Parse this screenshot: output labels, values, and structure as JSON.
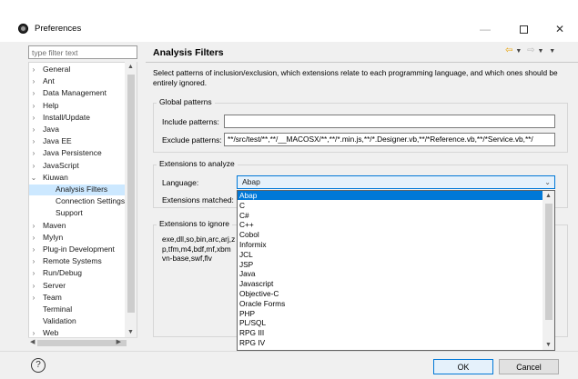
{
  "window": {
    "title": "Preferences",
    "minimize_glyph": "—",
    "close_glyph": "✕"
  },
  "filter": {
    "placeholder": "type filter text"
  },
  "tree": {
    "items": [
      {
        "label": "General",
        "arrow": "›",
        "level": 0
      },
      {
        "label": "Ant",
        "arrow": "›",
        "level": 0
      },
      {
        "label": "Data Management",
        "arrow": "›",
        "level": 0
      },
      {
        "label": "Help",
        "arrow": "›",
        "level": 0
      },
      {
        "label": "Install/Update",
        "arrow": "›",
        "level": 0
      },
      {
        "label": "Java",
        "arrow": "›",
        "level": 0
      },
      {
        "label": "Java EE",
        "arrow": "›",
        "level": 0
      },
      {
        "label": "Java Persistence",
        "arrow": "›",
        "level": 0
      },
      {
        "label": "JavaScript",
        "arrow": "›",
        "level": 0
      },
      {
        "label": "Kiuwan",
        "arrow": "⌄",
        "level": 0
      },
      {
        "label": "Analysis Filters",
        "arrow": "",
        "level": 1,
        "selected": true
      },
      {
        "label": "Connection Settings",
        "arrow": "",
        "level": 1
      },
      {
        "label": "Support",
        "arrow": "",
        "level": 1
      },
      {
        "label": "Maven",
        "arrow": "›",
        "level": 0
      },
      {
        "label": "Mylyn",
        "arrow": "›",
        "level": 0
      },
      {
        "label": "Plug-in Development",
        "arrow": "›",
        "level": 0
      },
      {
        "label": "Remote Systems",
        "arrow": "›",
        "level": 0
      },
      {
        "label": "Run/Debug",
        "arrow": "›",
        "level": 0
      },
      {
        "label": "Server",
        "arrow": "›",
        "level": 0
      },
      {
        "label": "Team",
        "arrow": "›",
        "level": 0
      },
      {
        "label": "Terminal",
        "arrow": "",
        "level": 0
      },
      {
        "label": "Validation",
        "arrow": "",
        "level": 0
      },
      {
        "label": "Web",
        "arrow": "›",
        "level": 0
      }
    ]
  },
  "page": {
    "title": "Analysis Filters",
    "description": "Select patterns of inclusion/exclusion, which extensions relate to each programming language, and which ones should be entirely ignored."
  },
  "global_patterns": {
    "title": "Global patterns",
    "include_label": "Include patterns:",
    "include_value": "",
    "exclude_label": "Exclude patterns:",
    "exclude_value": "**/src/test/**,**/__MACOSX/**,**/*.min.js,**/*.Designer.vb,**/*Reference.vb,**/*Service.vb,**/"
  },
  "extensions_analyze": {
    "title": "Extensions to analyze",
    "language_label": "Language:",
    "language_value": "Abap",
    "matched_label": "Extensions matched:"
  },
  "extensions_ignore": {
    "title": "Extensions to ignore",
    "text": "exe,dll,so,bin,arc,arj,z p,tfm,m4,bdf,mf,xbm vn-base,swf,flv"
  },
  "language_dropdown": {
    "options": [
      "Abap",
      "C",
      "C#",
      "C++",
      "Cobol",
      "Informix",
      "JCL",
      "JSP",
      "Java",
      "Javascript",
      "Objective-C",
      "Oracle Forms",
      "PHP",
      "PL/SQL",
      "RPG III",
      "RPG IV"
    ],
    "selected_index": 0
  },
  "footer": {
    "help_glyph": "?",
    "ok_label": "OK",
    "cancel_label": "Cancel"
  }
}
